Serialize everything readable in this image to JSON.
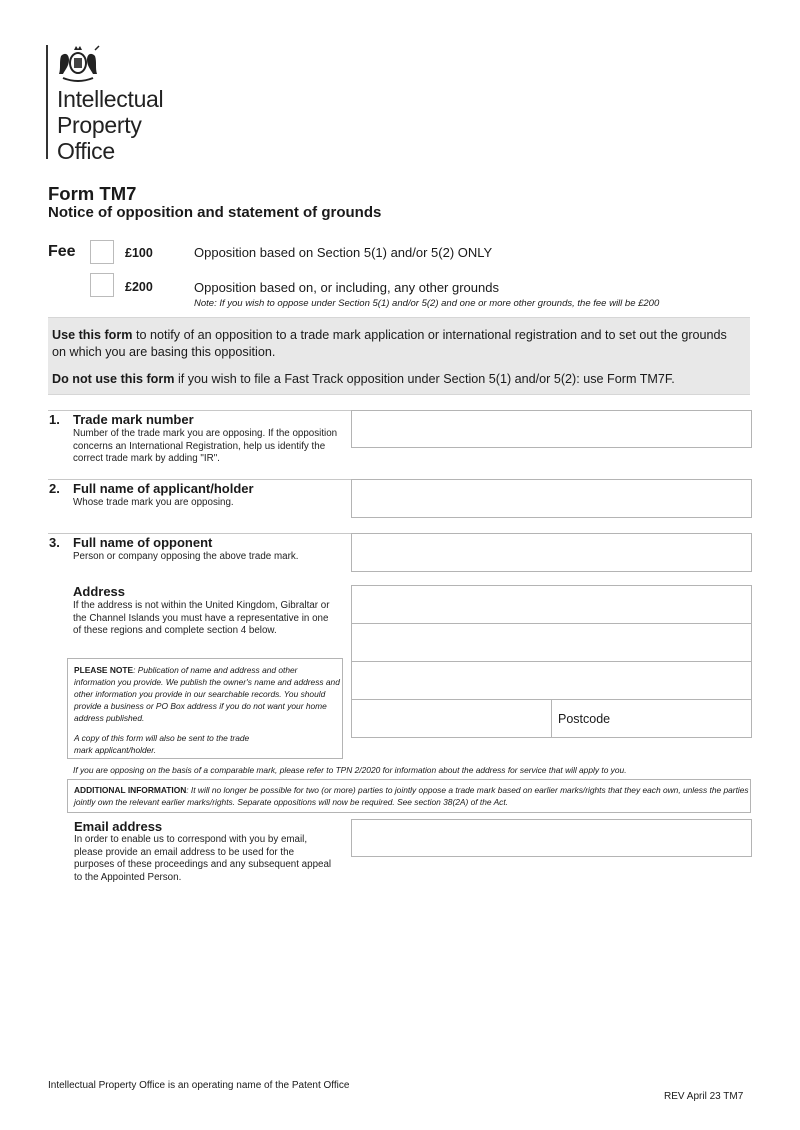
{
  "logo": {
    "crest_icon": "royal-coat-of-arms",
    "lines": [
      "Intellectual",
      "Property",
      "Office"
    ]
  },
  "header": {
    "title": "Form TM7",
    "subtitle": "Notice of opposition and statement of grounds"
  },
  "fee": {
    "label": "Fee",
    "options": [
      {
        "amount": "£100",
        "description": "Opposition based on Section 5(1) and/or 5(2) ONLY",
        "checked": false
      },
      {
        "amount": "£200",
        "description": "Opposition based on, or including, any other grounds",
        "checked": false
      }
    ],
    "note": "Note: If you wish to oppose under Section 5(1) and/or 5(2) and one or more other grounds, the fee will be £200"
  },
  "info": {
    "use_bold": "Use this form",
    "use_text": " to notify of an opposition to a trade mark application or international registration and to set out the grounds on which you are basing this opposition.",
    "dont_bold": "Do not use this form",
    "dont_text": " if you wish to file a Fast Track opposition under Section 5(1) and/or 5(2): use Form TM7F."
  },
  "sections": [
    {
      "number": "1.",
      "title": "Trade mark number",
      "description": "Number of the trade mark you are opposing. If the opposition concerns an International Registration, help us identify the correct trade mark by adding \"IR\".",
      "value": ""
    },
    {
      "number": "2.",
      "title": "Full name of applicant/holder",
      "description": "Whose trade mark you are opposing.",
      "value": ""
    },
    {
      "number": "3.",
      "title": "Full name of opponent",
      "description": "Person or company opposing the above trade mark.",
      "value": ""
    }
  ],
  "address": {
    "title": "Address",
    "description": "If the address is not within the United Kingdom, Gibraltar or the Channel Islands you must have a representative in one of these regions and complete section 4 below.",
    "lines": [
      "",
      "",
      ""
    ],
    "postcode_label": "Postcode",
    "postcode_value": "",
    "please_note_bold": "PLEASE NOTE",
    "please_note_text": ": Publication of name and address and other information you provide. We publish the owner's name and address and other information you provide in our searchable records. You should provide a business or PO Box address if you do not want your home address published.",
    "copy_note": "A copy of this form will also be sent to the trade mark applicant/holder."
  },
  "comparable_note": "If you are opposing on the basis of a comparable mark, please refer to TPN 2/2020 for information about the address for service that will apply to you.",
  "additional": {
    "bold": "ADDITIONAL INFORMATION",
    "text": ": It will no longer be possible for two (or more) parties to jointly oppose a trade mark based on earlier marks/rights that they each own, unless the parties jointly own the relevant earlier marks/rights. Separate oppositions will now be required. See section 38(2A) of the Act."
  },
  "email": {
    "title": "Email address",
    "description": "In order to enable us to correspond with you by email, please provide an email address to be used for the purposes of these proceedings and any subsequent appeal to the Appointed Person.",
    "value": ""
  },
  "footer": {
    "left": "Intellectual Property Office is an operating name of the Patent Office",
    "right": "REV April 23 TM7"
  }
}
